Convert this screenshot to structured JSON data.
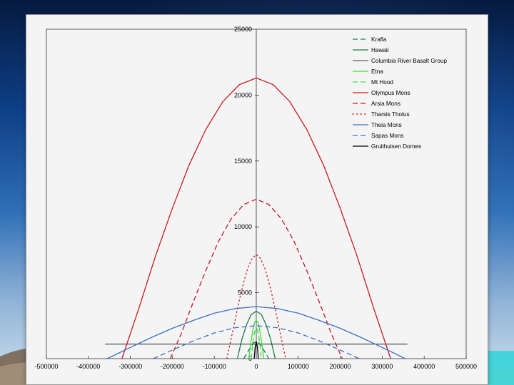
{
  "chart_data": {
    "type": "line",
    "title": "",
    "xlabel": "",
    "ylabel": "",
    "xlim": [
      -500000,
      500000
    ],
    "ylim": [
      0,
      25000
    ],
    "x_ticks": [
      -500000,
      -400000,
      -300000,
      -200000,
      -100000,
      0,
      100000,
      200000,
      300000,
      400000,
      500000
    ],
    "x_tick_labels": [
      "-500000",
      "-400000",
      "-300000",
      "-200000",
      "-100000",
      "0",
      "100000",
      "200000",
      "300000",
      "400000",
      "500000"
    ],
    "y_ticks": [
      0,
      5000,
      10000,
      15000,
      20000,
      25000
    ],
    "y_tick_labels": [
      "0",
      "5000",
      "10000",
      "15000",
      "20000",
      "25000"
    ],
    "grid": false,
    "legend_position": "top-right",
    "series": [
      {
        "name": "Krafla",
        "color": "#1f7a4a",
        "dash": "dash",
        "width": 1.3,
        "x": [
          -30000,
          -22000,
          -14000,
          -7000,
          0,
          7000,
          14000,
          22000,
          30000
        ],
        "y": [
          0,
          430,
          860,
          1180,
          1300,
          1180,
          860,
          430,
          0
        ]
      },
      {
        "name": "Hawaii",
        "color": "#1f7a4a",
        "dash": "solid",
        "width": 1.3,
        "x": [
          -45000,
          -34000,
          -23000,
          -12000,
          0,
          12000,
          23000,
          34000,
          45000
        ],
        "y": [
          0,
          1500,
          2600,
          3350,
          3600,
          3350,
          2600,
          1500,
          0
        ]
      },
      {
        "name": "Columbia River Basalt Group",
        "color": "#000000",
        "dash": "solid",
        "width": 0.8,
        "x": [
          -360000,
          360000
        ],
        "y": [
          1100,
          1100
        ]
      },
      {
        "name": "Etna",
        "color": "#3ddc3d",
        "dash": "solid",
        "width": 1.3,
        "x": [
          -18000,
          -13000,
          -8000,
          -4000,
          0,
          4000,
          8000,
          13000,
          18000
        ],
        "y": [
          0,
          1200,
          2200,
          2750,
          2900,
          2750,
          2200,
          1200,
          0
        ]
      },
      {
        "name": "Mt Hood",
        "color": "#3ddc3d",
        "dash": "dash",
        "width": 1.3,
        "x": [
          -12000,
          -9000,
          -6000,
          -3000,
          0,
          3000,
          6000,
          9000,
          12000
        ],
        "y": [
          0,
          950,
          1700,
          2150,
          2300,
          2150,
          1700,
          950,
          0
        ]
      },
      {
        "name": "Olympus Mons",
        "color": "#c8191e",
        "dash": "solid",
        "width": 1.3,
        "x": [
          -320000,
          -280000,
          -240000,
          -200000,
          -160000,
          -120000,
          -80000,
          -40000,
          0,
          40000,
          80000,
          120000,
          160000,
          200000,
          240000,
          280000,
          320000
        ],
        "y": [
          0,
          3800,
          7800,
          11400,
          14700,
          17400,
          19500,
          20800,
          21300,
          20800,
          19500,
          17400,
          14700,
          11400,
          7800,
          3800,
          0
        ]
      },
      {
        "name": "Arsia Mons",
        "color": "#c8191e",
        "dash": "dash",
        "width": 1.3,
        "x": [
          -205000,
          -180000,
          -150000,
          -120000,
          -90000,
          -60000,
          -30000,
          0,
          30000,
          60000,
          90000,
          120000,
          150000,
          180000,
          205000
        ],
        "y": [
          0,
          1800,
          4300,
          6700,
          8900,
          10600,
          11700,
          12100,
          11700,
          10600,
          8900,
          6700,
          4300,
          1800,
          0
        ]
      },
      {
        "name": "Tharsis Tholus",
        "color": "#c8191e",
        "dash": "dot",
        "width": 1.3,
        "x": [
          -70000,
          -60000,
          -50000,
          -40000,
          -30000,
          -20000,
          -10000,
          0,
          10000,
          20000,
          30000,
          40000,
          50000,
          60000,
          70000
        ],
        "y": [
          0,
          1500,
          3000,
          4500,
          5800,
          6900,
          7600,
          7900,
          7600,
          6900,
          5800,
          4500,
          3000,
          1500,
          0
        ]
      },
      {
        "name": "Theia Mons",
        "color": "#3a6fc4",
        "dash": "solid",
        "width": 1.3,
        "x": [
          -355000,
          -300000,
          -250000,
          -200000,
          -150000,
          -100000,
          -50000,
          0,
          50000,
          100000,
          150000,
          200000,
          250000,
          300000,
          355000
        ],
        "y": [
          0,
          850,
          1600,
          2300,
          2900,
          3450,
          3800,
          3950,
          3800,
          3450,
          2900,
          2300,
          1600,
          850,
          0
        ]
      },
      {
        "name": "Sapas Mons",
        "color": "#3a6fc4",
        "dash": "dash",
        "width": 1.3,
        "x": [
          -245000,
          -200000,
          -150000,
          -100000,
          -50000,
          0,
          50000,
          100000,
          150000,
          200000,
          245000
        ],
        "y": [
          0,
          650,
          1350,
          1950,
          2350,
          2500,
          2350,
          1950,
          1350,
          650,
          0
        ]
      },
      {
        "name": "Gruithuisen Domes",
        "color": "#000000",
        "dash": "solid",
        "width": 1.3,
        "x": [
          -5000,
          -2500,
          0,
          2500,
          5000
        ],
        "y": [
          0,
          900,
          1300,
          900,
          0
        ]
      }
    ]
  }
}
